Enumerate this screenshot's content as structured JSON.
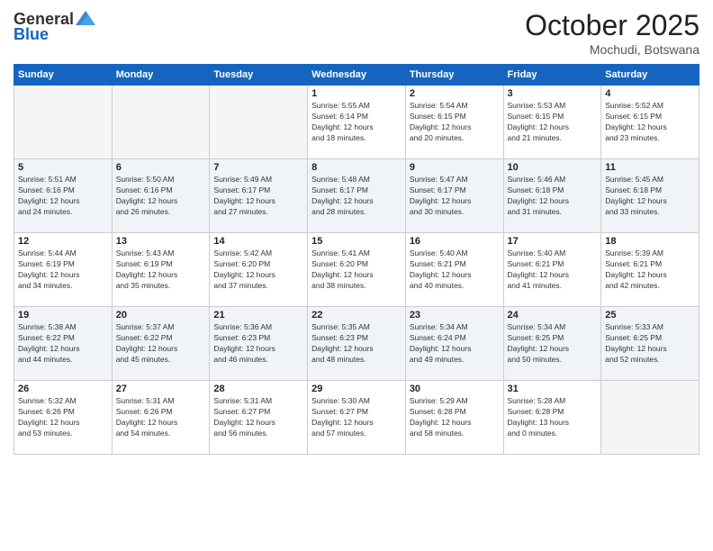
{
  "header": {
    "logo_general": "General",
    "logo_blue": "Blue",
    "month_year": "October 2025",
    "location": "Mochudi, Botswana"
  },
  "weekdays": [
    "Sunday",
    "Monday",
    "Tuesday",
    "Wednesday",
    "Thursday",
    "Friday",
    "Saturday"
  ],
  "weeks": [
    [
      {
        "day": "",
        "info": ""
      },
      {
        "day": "",
        "info": ""
      },
      {
        "day": "",
        "info": ""
      },
      {
        "day": "1",
        "info": "Sunrise: 5:55 AM\nSunset: 6:14 PM\nDaylight: 12 hours\nand 18 minutes."
      },
      {
        "day": "2",
        "info": "Sunrise: 5:54 AM\nSunset: 6:15 PM\nDaylight: 12 hours\nand 20 minutes."
      },
      {
        "day": "3",
        "info": "Sunrise: 5:53 AM\nSunset: 6:15 PM\nDaylight: 12 hours\nand 21 minutes."
      },
      {
        "day": "4",
        "info": "Sunrise: 5:52 AM\nSunset: 6:15 PM\nDaylight: 12 hours\nand 23 minutes."
      }
    ],
    [
      {
        "day": "5",
        "info": "Sunrise: 5:51 AM\nSunset: 6:16 PM\nDaylight: 12 hours\nand 24 minutes."
      },
      {
        "day": "6",
        "info": "Sunrise: 5:50 AM\nSunset: 6:16 PM\nDaylight: 12 hours\nand 26 minutes."
      },
      {
        "day": "7",
        "info": "Sunrise: 5:49 AM\nSunset: 6:17 PM\nDaylight: 12 hours\nand 27 minutes."
      },
      {
        "day": "8",
        "info": "Sunrise: 5:48 AM\nSunset: 6:17 PM\nDaylight: 12 hours\nand 28 minutes."
      },
      {
        "day": "9",
        "info": "Sunrise: 5:47 AM\nSunset: 6:17 PM\nDaylight: 12 hours\nand 30 minutes."
      },
      {
        "day": "10",
        "info": "Sunrise: 5:46 AM\nSunset: 6:18 PM\nDaylight: 12 hours\nand 31 minutes."
      },
      {
        "day": "11",
        "info": "Sunrise: 5:45 AM\nSunset: 6:18 PM\nDaylight: 12 hours\nand 33 minutes."
      }
    ],
    [
      {
        "day": "12",
        "info": "Sunrise: 5:44 AM\nSunset: 6:19 PM\nDaylight: 12 hours\nand 34 minutes."
      },
      {
        "day": "13",
        "info": "Sunrise: 5:43 AM\nSunset: 6:19 PM\nDaylight: 12 hours\nand 35 minutes."
      },
      {
        "day": "14",
        "info": "Sunrise: 5:42 AM\nSunset: 6:20 PM\nDaylight: 12 hours\nand 37 minutes."
      },
      {
        "day": "15",
        "info": "Sunrise: 5:41 AM\nSunset: 6:20 PM\nDaylight: 12 hours\nand 38 minutes."
      },
      {
        "day": "16",
        "info": "Sunrise: 5:40 AM\nSunset: 6:21 PM\nDaylight: 12 hours\nand 40 minutes."
      },
      {
        "day": "17",
        "info": "Sunrise: 5:40 AM\nSunset: 6:21 PM\nDaylight: 12 hours\nand 41 minutes."
      },
      {
        "day": "18",
        "info": "Sunrise: 5:39 AM\nSunset: 6:21 PM\nDaylight: 12 hours\nand 42 minutes."
      }
    ],
    [
      {
        "day": "19",
        "info": "Sunrise: 5:38 AM\nSunset: 6:22 PM\nDaylight: 12 hours\nand 44 minutes."
      },
      {
        "day": "20",
        "info": "Sunrise: 5:37 AM\nSunset: 6:22 PM\nDaylight: 12 hours\nand 45 minutes."
      },
      {
        "day": "21",
        "info": "Sunrise: 5:36 AM\nSunset: 6:23 PM\nDaylight: 12 hours\nand 46 minutes."
      },
      {
        "day": "22",
        "info": "Sunrise: 5:35 AM\nSunset: 6:23 PM\nDaylight: 12 hours\nand 48 minutes."
      },
      {
        "day": "23",
        "info": "Sunrise: 5:34 AM\nSunset: 6:24 PM\nDaylight: 12 hours\nand 49 minutes."
      },
      {
        "day": "24",
        "info": "Sunrise: 5:34 AM\nSunset: 6:25 PM\nDaylight: 12 hours\nand 50 minutes."
      },
      {
        "day": "25",
        "info": "Sunrise: 5:33 AM\nSunset: 6:25 PM\nDaylight: 12 hours\nand 52 minutes."
      }
    ],
    [
      {
        "day": "26",
        "info": "Sunrise: 5:32 AM\nSunset: 6:26 PM\nDaylight: 12 hours\nand 53 minutes."
      },
      {
        "day": "27",
        "info": "Sunrise: 5:31 AM\nSunset: 6:26 PM\nDaylight: 12 hours\nand 54 minutes."
      },
      {
        "day": "28",
        "info": "Sunrise: 5:31 AM\nSunset: 6:27 PM\nDaylight: 12 hours\nand 56 minutes."
      },
      {
        "day": "29",
        "info": "Sunrise: 5:30 AM\nSunset: 6:27 PM\nDaylight: 12 hours\nand 57 minutes."
      },
      {
        "day": "30",
        "info": "Sunrise: 5:29 AM\nSunset: 6:28 PM\nDaylight: 12 hours\nand 58 minutes."
      },
      {
        "day": "31",
        "info": "Sunrise: 5:28 AM\nSunset: 6:28 PM\nDaylight: 13 hours\nand 0 minutes."
      },
      {
        "day": "",
        "info": ""
      }
    ]
  ]
}
